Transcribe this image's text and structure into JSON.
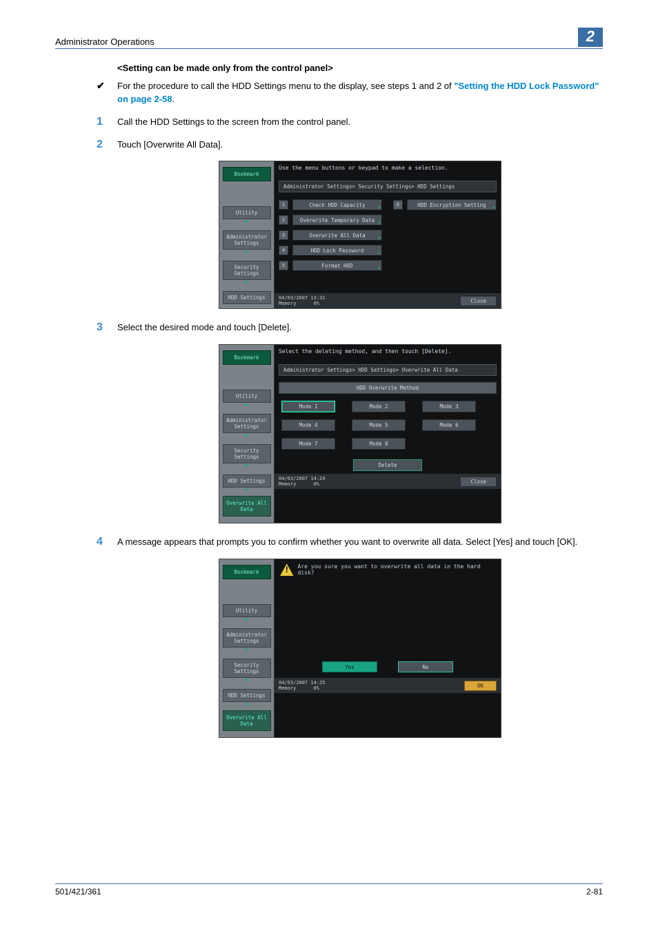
{
  "header": {
    "title": "Administrator Operations",
    "chapter": "2"
  },
  "section_title": "<Setting can be made only from the control panel>",
  "check_text_pre": "For the procedure to call the HDD Settings menu to the display, see steps 1 and 2 of ",
  "check_link": "\"Setting the HDD Lock Password\" on page 2-58",
  "check_text_post": ".",
  "steps": {
    "s1": "Call the HDD Settings to the screen from the control panel.",
    "s2": "Touch [Overwrite All Data].",
    "s3": "Select the desired mode and touch [Delete].",
    "s4": "A message appears that prompts you to confirm whether you want to overwrite all data. Select [Yes] and touch [OK]."
  },
  "panel1": {
    "prompt": "Use the menu buttons or keypad to make a selection.",
    "path": "Administrator Settings> Security Settings> HDD Settings",
    "side": {
      "bookmark": "Bookmark",
      "utility": "Utility",
      "admin": "Administrator Settings",
      "sec": "Security Settings",
      "hdd": "HDD Settings"
    },
    "options": [
      {
        "n": "1",
        "t": "Check HDD Capacity"
      },
      {
        "n": "2",
        "t": "Overwrite Temporary Data"
      },
      {
        "n": "3",
        "t": "Overwrite All Data"
      },
      {
        "n": "4",
        "t": "HDD Lock Password"
      },
      {
        "n": "5",
        "t": "Format HDD"
      }
    ],
    "opt6_n": "6",
    "opt6_t": "HDD Encryption Setting",
    "dt": "04/03/2007   13:32",
    "mem_label": "Memory",
    "mem_val": "0%",
    "close": "Close"
  },
  "panel2": {
    "prompt": "Select the deleting method, and then touch [Delete].",
    "path": "Administrator Settings> HDD Settings> Overwrite All Data",
    "title": "HDD Overwrite Method",
    "side": {
      "bookmark": "Bookmark",
      "utility": "Utility",
      "admin": "Administrator Settings",
      "sec": "Security Settings",
      "hdd": "HDD Settings",
      "ov": "Overwrite All Data"
    },
    "modes": [
      "Mode 1",
      "Mode 2",
      "Mode 3",
      "Mode 4",
      "Mode 5",
      "Mode 6",
      "Mode 7",
      "Mode 8"
    ],
    "delete": "Delete",
    "dt": "04/03/2007   14:24",
    "mem_label": "Memory",
    "mem_val": "0%",
    "close": "Close"
  },
  "panel3": {
    "prompt": "Are you sure you want to overwrite all data in the hard disk?",
    "side": {
      "bookmark": "Bookmark",
      "utility": "Utility",
      "admin": "Administrator Settings",
      "sec": "Security Settings",
      "hdd": "HDD Settings",
      "ov": "Overwrite All Data"
    },
    "yes": "Yes",
    "no": "No",
    "ok": "OK",
    "dt": "04/03/2007   14:25",
    "mem_label": "Memory",
    "mem_val": "0%"
  },
  "footer": {
    "left": "501/421/361",
    "right": "2-81"
  }
}
